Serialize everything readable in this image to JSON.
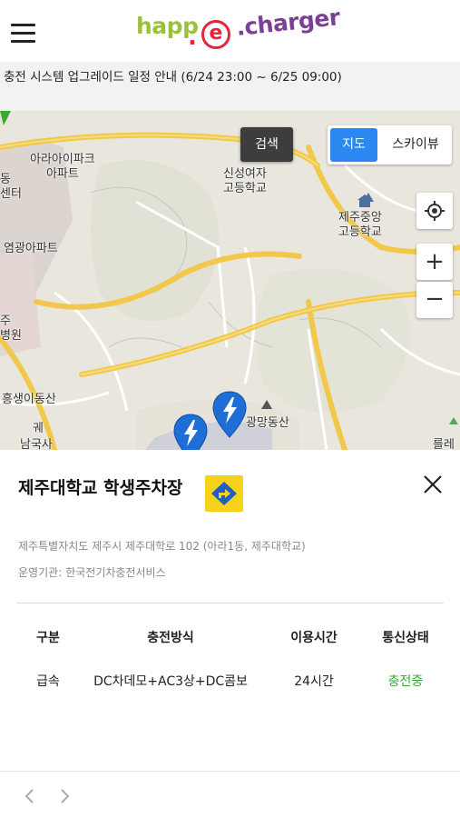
{
  "header": {
    "logo_part1": "happ",
    "logo_dot": ".",
    "logo_e": "e",
    "logo_part2": ".charger",
    "colors": {
      "green": "#9dc03a",
      "red": "#e5253b",
      "purple": "#7b3f98"
    }
  },
  "notice": {
    "text": "충전 시스템 업그레이드 일정 안내 (6/24 23:00 ~ 6/25 09:00)"
  },
  "map": {
    "search_label": "검색",
    "maptype_map": "지도",
    "maptype_sky": "스카이뷰",
    "zoom_in": "+",
    "zoom_out": "−",
    "labels": {
      "l1a": "아라아이파크",
      "l1b": "아파트",
      "l2a": "동",
      "l2b": "센터",
      "l3a": "신성여자",
      "l3b": "고등학교",
      "l4a": "제주중앙",
      "l4b": "고등학교",
      "l5": "염광아파트",
      "l6a": "주",
      "l6b": "병원",
      "l7": "흥생이동산",
      "l8": "궤",
      "l9": "남국사",
      "l10": "광망동산",
      "l11": "를레"
    }
  },
  "station": {
    "name": "제주대학교 학생주차장",
    "address": "제주특별자치도 제주시 제주대학로 102 (아라1동, 제주대학교)",
    "operator_label": "운영기관:",
    "operator": "한국전기차충전서비스",
    "table": {
      "headers": [
        "구분",
        "충전방식",
        "이용시간",
        "통신상태"
      ],
      "row": [
        "급속",
        "DC차데모+AC3상+DC콤보",
        "24시간",
        "충전중"
      ]
    }
  },
  "colors": {
    "accent": "#2a88f0",
    "status_ok": "#3aaa35",
    "badge": "#f5d21b",
    "marker": "#1d6fd6"
  }
}
